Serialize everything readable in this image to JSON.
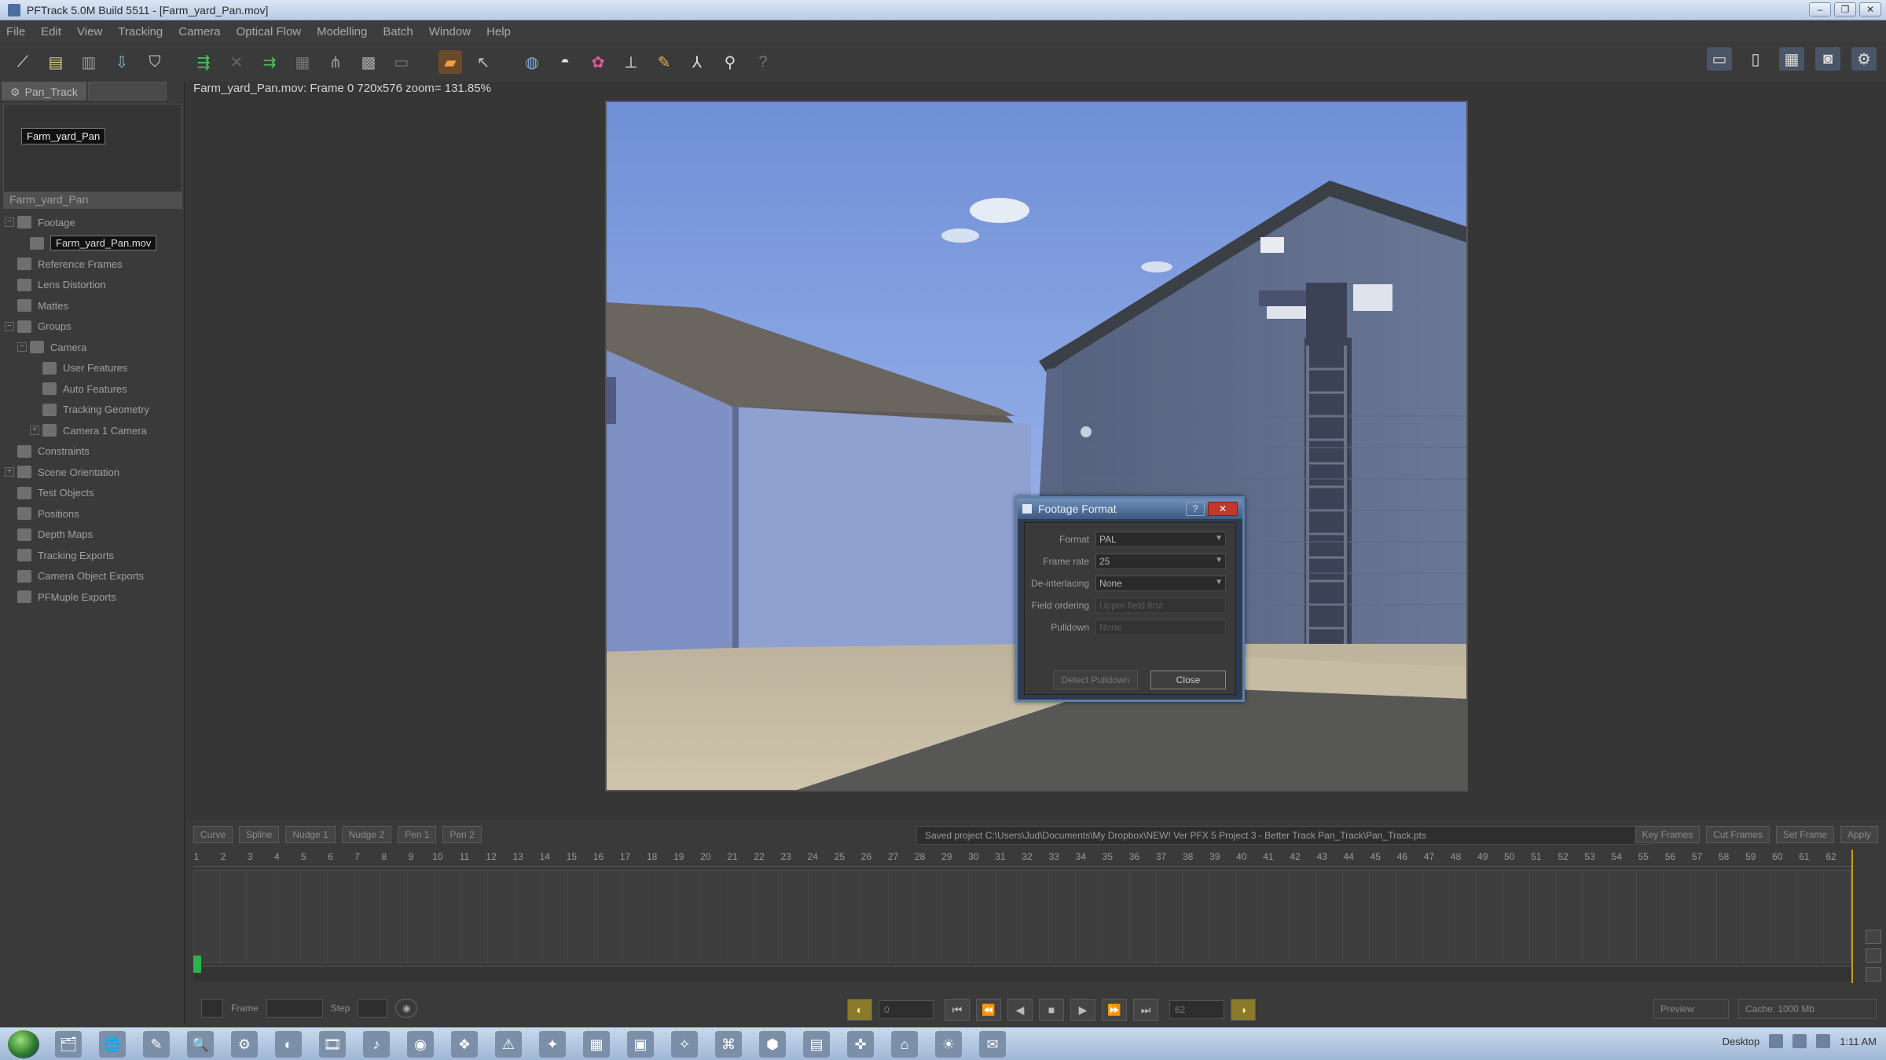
{
  "window": {
    "title": "PFTrack 5.0M Build 5511 - [Farm_yard_Pan.mov]",
    "controls": [
      "–",
      "❐",
      "✕"
    ]
  },
  "menu": [
    "File",
    "Edit",
    "View",
    "Tracking",
    "Camera",
    "Optical Flow",
    "Modelling",
    "Batch",
    "Window",
    "Help"
  ],
  "toolbar": {
    "icons": [
      "wand-icon",
      "document-icon",
      "stack-icon",
      "import-icon",
      "shield-icon",
      "track-icon",
      "link-icon",
      "merge-icon",
      "grid-small-icon",
      "tree-icon",
      "grid-icon",
      "film-icon",
      "clapper-icon",
      "cursor-icon",
      "sphere-icon",
      "mesh-icon",
      "flower-icon",
      "axis-icon",
      "edit-icon",
      "measure-icon",
      "bone-icon",
      "question-icon"
    ],
    "right_icons": [
      "layout-single-icon",
      "layout-split-icon",
      "layout-quad-icon",
      "camera-view-icon",
      "gear-view-icon"
    ]
  },
  "left_panel": {
    "tabs": [
      "Pan_Track",
      ""
    ],
    "clip_chip": "Farm_yard_Pan",
    "tree_header": "Farm_yard_Pan",
    "tree": [
      {
        "label": "Footage",
        "indent": 0,
        "toggle": "−"
      },
      {
        "label": "Farm_yard_Pan.mov",
        "indent": 1,
        "selected": true
      },
      {
        "label": "Reference Frames",
        "indent": 0
      },
      {
        "label": "Lens Distortion",
        "indent": 0
      },
      {
        "label": "Mattes",
        "indent": 0
      },
      {
        "label": "Groups",
        "indent": 0,
        "toggle": "−"
      },
      {
        "label": "Camera",
        "indent": 1,
        "toggle": "−"
      },
      {
        "label": "User Features",
        "indent": 2
      },
      {
        "label": "Auto Features",
        "indent": 2
      },
      {
        "label": "Tracking Geometry",
        "indent": 2
      },
      {
        "label": "Camera 1 Camera",
        "indent": 2,
        "toggle": "+"
      },
      {
        "label": "Constraints",
        "indent": 0
      },
      {
        "label": "Scene Orientation",
        "indent": 0,
        "toggle": "+"
      },
      {
        "label": "Test Objects",
        "indent": 0
      },
      {
        "label": "Positions",
        "indent": 0
      },
      {
        "label": "Depth Maps",
        "indent": 0
      },
      {
        "label": "Tracking Exports",
        "indent": 0
      },
      {
        "label": "Camera Object Exports",
        "indent": 0
      },
      {
        "label": "PFMuple Exports",
        "indent": 0
      }
    ]
  },
  "viewport": {
    "info": "Farm_yard_Pan.mov: Frame 0 720x576 zoom= 131.85%"
  },
  "dialog": {
    "title": "Footage Format",
    "help": "?",
    "close": "✕",
    "rows": [
      {
        "label": "Format",
        "value": "PAL",
        "dropdown": true,
        "disabled": false
      },
      {
        "label": "Frame rate",
        "value": "25",
        "dropdown": true,
        "disabled": false
      },
      {
        "label": "De-interlacing",
        "value": "None",
        "dropdown": true,
        "disabled": false
      },
      {
        "label": "Field ordering",
        "value": "Upper field first",
        "dropdown": false,
        "disabled": true
      },
      {
        "label": "Pulldown",
        "value": "None",
        "dropdown": false,
        "disabled": true
      }
    ],
    "detect_button": "Detect Pulldown",
    "close_button": "Close"
  },
  "timeline": {
    "tabs": [
      "Curve",
      "Spline",
      "Nudge 1",
      "Nudge 2",
      "Pen 1",
      "Pen 2"
    ],
    "status": "Saved project C:\\Users\\Jud\\Documents\\My Dropbox\\NEW! Ver PFX 5 Project 3 - Better Track Pan_Track\\Pan_Track.pts",
    "right_tabs": [
      "Key Frames",
      "Cut Frames",
      "Set Frame",
      "Apply"
    ],
    "ticks": [
      "1",
      "2",
      "3",
      "4",
      "5",
      "6",
      "7",
      "8",
      "9",
      "10",
      "11",
      "12",
      "13",
      "14",
      "15",
      "16",
      "17",
      "18",
      "19",
      "20",
      "21",
      "22",
      "23",
      "24",
      "25",
      "26",
      "27",
      "28",
      "29",
      "30",
      "31",
      "32",
      "33",
      "34",
      "35",
      "36",
      "37",
      "38",
      "39",
      "40",
      "41",
      "42",
      "43",
      "44",
      "45",
      "46",
      "47",
      "48",
      "49",
      "50",
      "51",
      "52",
      "53",
      "54",
      "55",
      "56",
      "57",
      "58",
      "59",
      "60",
      "61",
      "62"
    ]
  },
  "transport": {
    "frame_label": "Frame",
    "step_label": "Step",
    "start_value": "0",
    "end_value": "62",
    "buttons": [
      "⏮",
      "⏪",
      "◀",
      "■",
      "▶",
      "⏩",
      "⏭"
    ],
    "preview_select": "Preview",
    "cache_select": "Cache: 1000 Mb"
  },
  "taskbar": {
    "apps": [
      "🗂",
      "🌐",
      "✎",
      "🔍",
      "⚙",
      "◐",
      "🎞",
      "♪",
      "◉",
      "❖",
      "⚠",
      "✦",
      "▦",
      "▣",
      "✧",
      "⌘",
      "⬢",
      "▤",
      "✜",
      "⌂",
      "☀",
      "✉"
    ],
    "tray_label": "Desktop",
    "clock": "1:11 AM"
  }
}
